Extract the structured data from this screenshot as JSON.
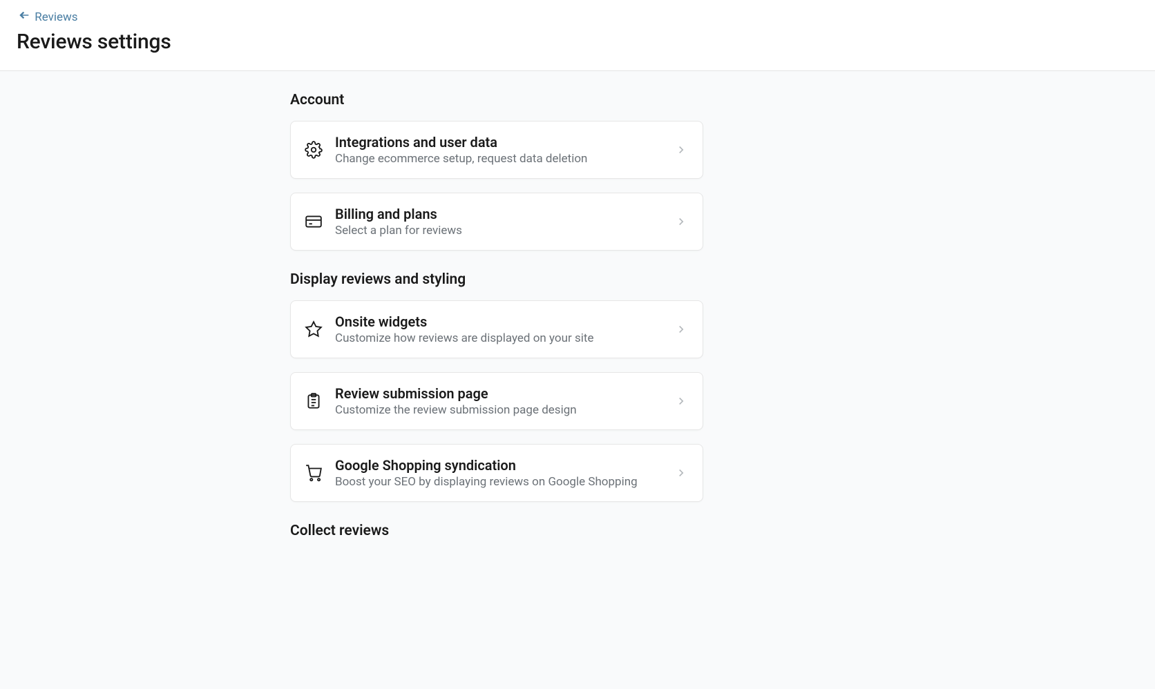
{
  "header": {
    "back_label": "Reviews",
    "title": "Reviews settings"
  },
  "sections": {
    "account": {
      "heading": "Account",
      "items": [
        {
          "title": "Integrations and user data",
          "desc": "Change ecommerce setup, request data deletion"
        },
        {
          "title": "Billing and plans",
          "desc": "Select a plan for reviews"
        }
      ]
    },
    "display": {
      "heading": "Display reviews and styling",
      "items": [
        {
          "title": "Onsite widgets",
          "desc": "Customize how reviews are displayed on your site"
        },
        {
          "title": "Review submission page",
          "desc": "Customize the review submission page design"
        },
        {
          "title": "Google Shopping syndication",
          "desc": "Boost your SEO by displaying reviews on Google Shopping"
        }
      ]
    },
    "collect": {
      "heading": "Collect reviews"
    }
  }
}
